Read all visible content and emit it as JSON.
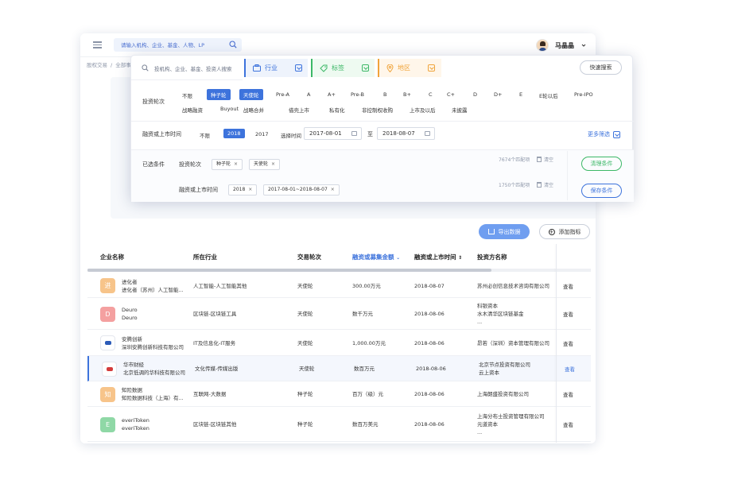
{
  "header": {
    "search_placeholder": "请输入机构、企业、基金、人物、LP",
    "user_name": "马晶晶"
  },
  "breadcrumb": [
    "股权交易",
    "/",
    "全部事"
  ],
  "filter": {
    "search_placeholder": "投机构、企业、基金、投资人搜索",
    "dropdowns": {
      "industry": "行业",
      "tag": "标签",
      "region": "地区"
    },
    "quick_search": "快速搜索",
    "round_label": "投资轮次",
    "round_options_row1": [
      "不限",
      "种子轮",
      "天使轮",
      "Pre-A",
      "A",
      "A+",
      "Pre-B",
      "B",
      "B+",
      "C",
      "C+",
      "D",
      "D+",
      "E",
      "E轮以后",
      "Pre-IPO"
    ],
    "round_options_row2": [
      "战略融资",
      "Buyout",
      "战略合并",
      "借壳上市",
      "私有化",
      "非控制权收购",
      "上市及以后",
      "未披露"
    ],
    "selected_rounds": [
      "种子轮",
      "天使轮"
    ],
    "time_label": "融资或上市时间",
    "time_options": [
      "不限",
      "2018",
      "2017"
    ],
    "selected_time": "2018",
    "choose_time_label": "选择时间",
    "date_from": "2017-08-01",
    "to_label": "至",
    "date_to": "2018-08-07",
    "more_filters": "更多筛选",
    "selected_label": "已选条件",
    "cond1": {
      "label": "投资轮次",
      "chips": [
        "种子轮",
        "天使轮"
      ],
      "count": "7674个匹配项",
      "clear": "清空"
    },
    "cond2": {
      "label": "融资或上市时间",
      "chips": [
        "2018",
        "2017-08-01~2018-08-07"
      ],
      "count": "1750个匹配项",
      "clear": "清空"
    },
    "clear_btn": "清理条件",
    "save_btn": "保存条件",
    "chip_close": "×"
  },
  "actions": {
    "export": "导出数据",
    "add_metric": "添加指标"
  },
  "table": {
    "headers": [
      "企业名称",
      "所在行业",
      "交易轮次",
      "融资或募集金额",
      "融资或上市时间",
      "投资方名称"
    ],
    "view_label": "查看",
    "rows": [
      {
        "logo_text": "进",
        "logo_color": "#f7c48a",
        "name": "进化者",
        "full": "进化者（苏州）人工智能...",
        "industry": "人工智能-人工智能其他",
        "round": "天使轮",
        "amount": "300.00万元",
        "date": "2018-08-07",
        "investors": [
          "苏州必创信息技术咨询有限公司"
        ]
      },
      {
        "logo_text": "D",
        "logo_color": "#f4a0a0",
        "name": "Deuro",
        "full": "Deuro",
        "industry": "区块链-区块链工具",
        "round": "天使轮",
        "amount": "数千万元",
        "date": "2018-08-06",
        "investors": [
          "科银资本",
          "水木清华区块链基金",
          "..."
        ]
      },
      {
        "logo_text": "",
        "logo_color": "#ffffff",
        "name": "安腾创新",
        "full": "深圳安腾创新科技有限公司",
        "industry": "IT及信息化-IT服务",
        "round": "天使轮",
        "amount": "1,000.00万元",
        "date": "2018-08-06",
        "investors": [
          "昂若（深圳）资本管理有限公司"
        ]
      },
      {
        "logo_text": "",
        "logo_color": "#ffffff",
        "name": "华市财经",
        "full": "北京低调的华科技有限公司",
        "industry": "文化传媒-传媒出版",
        "round": "天使轮",
        "amount": "数百万元",
        "date": "2018-08-06",
        "investors": [
          "北京节点投资有限公司",
          "云上资本"
        ]
      },
      {
        "logo_text": "知",
        "logo_color": "#f7c48a",
        "name": "知险数据",
        "full": "知险数据科技（上海）有...",
        "industry": "互联网-大数据",
        "round": "种子轮",
        "amount": "百万（级）元",
        "date": "2018-08-06",
        "investors": [
          "上海朗盛投资有限公司"
        ]
      },
      {
        "logo_text": "E",
        "logo_color": "#8fd8a6",
        "name": "everiToken",
        "full": "everiToken",
        "industry": "区块链-区块链其他",
        "round": "种子轮",
        "amount": "数百万美元",
        "date": "2018-08-06",
        "investors": [
          "上海分布士投资管理有限公司",
          "元道资本",
          "..."
        ]
      }
    ]
  }
}
